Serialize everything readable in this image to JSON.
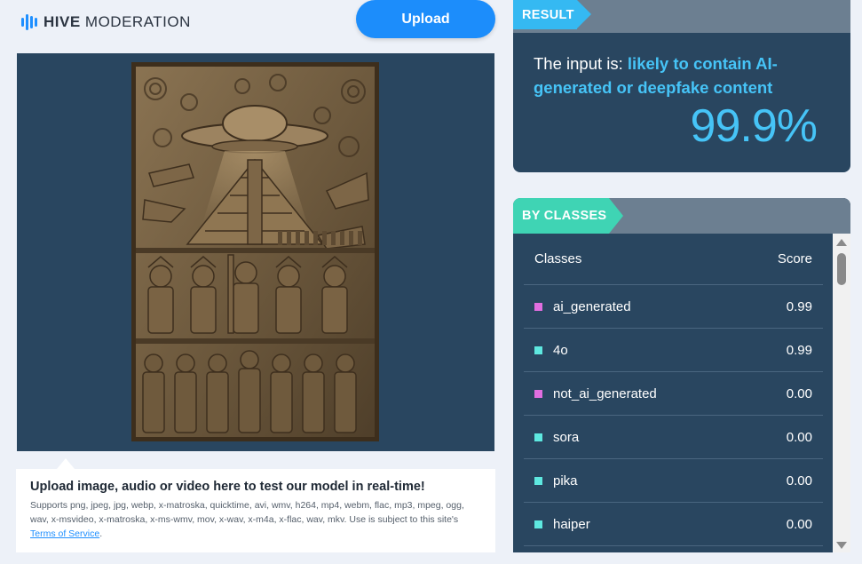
{
  "header": {
    "logo_bold": "HIVE",
    "logo_light": "MODERATION",
    "upload_label": "Upload"
  },
  "upload_info": {
    "title": "Upload image, audio or video here to test our model in real-time!",
    "supports": "Supports png, jpeg, jpg, webp, x-matroska, quicktime, avi, wmv, h264, mp4, webm, flac, mp3, mpeg, ogg, wav, x-msvideo, x-matroska, x-ms-wmv, mov, x-wav, x-m4a, x-flac, wav, mkv. Use is subject to this site's ",
    "terms_link": "Terms of Service",
    "terms_end": "."
  },
  "result": {
    "tag": "RESULT",
    "prefix": "The input is: ",
    "verdict": "likely to contain AI-generated or deepfake content",
    "score": "99.9%"
  },
  "classes": {
    "tag": "BY CLASSES",
    "col_class": "Classes",
    "col_score": "Score",
    "rows": [
      {
        "name": "ai_generated",
        "score": "0.99",
        "color": "#e06ee0"
      },
      {
        "name": "4o",
        "score": "0.99",
        "color": "#5ee8e0"
      },
      {
        "name": "not_ai_generated",
        "score": "0.00",
        "color": "#e06ee0"
      },
      {
        "name": "sora",
        "score": "0.00",
        "color": "#5ee8e0"
      },
      {
        "name": "pika",
        "score": "0.00",
        "color": "#5ee8e0"
      },
      {
        "name": "haiper",
        "score": "0.00",
        "color": "#5ee8e0"
      }
    ]
  },
  "colors": {
    "accent_blue": "#1c8dfb",
    "result_tag": "#35b9f2",
    "classes_tag": "#3fd4b4",
    "panel_bg": "#294660"
  }
}
